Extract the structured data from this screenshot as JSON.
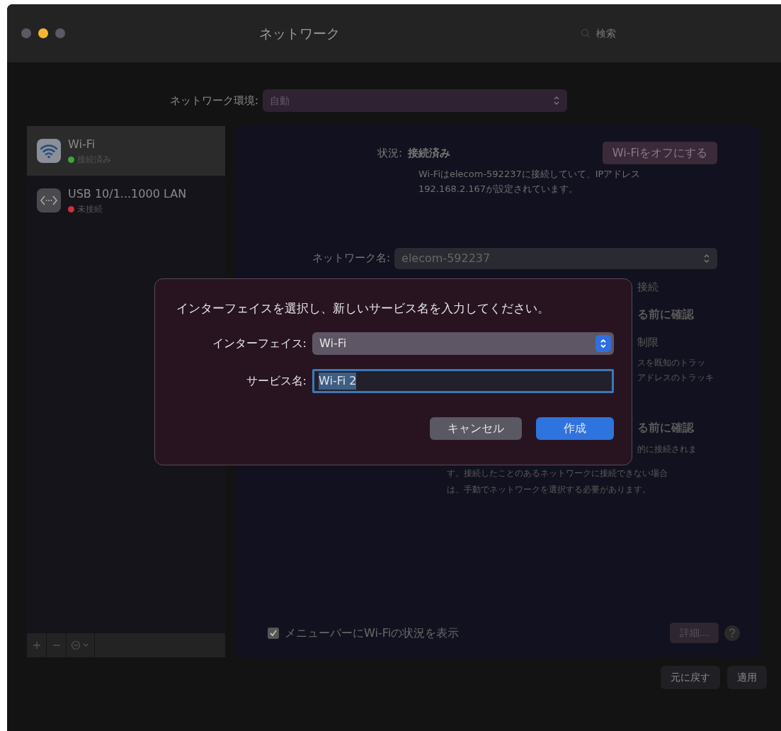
{
  "window": {
    "title": "ネットワーク",
    "search": {
      "placeholder": "検索"
    }
  },
  "location": {
    "label": "ネットワーク環境:",
    "value": "自動"
  },
  "services": [
    {
      "name": "Wi-Fi",
      "status": "接続済み",
      "color": "#3aa63a",
      "kind": "wifi",
      "selected": true
    },
    {
      "name": "USB 10/1...1000 LAN",
      "status": "未接続",
      "color": "#c8333a",
      "kind": "ethernet",
      "selected": false
    }
  ],
  "detail": {
    "status_label": "状況:",
    "status_value": "接続済み",
    "toggle_button": "Wi-Fiをオフにする",
    "description": "Wi-Fiはelecom-592237に接続していて、IPアドレス 192.168.2.167が設定されています。",
    "network_name_label": "ネットワーク名:",
    "network_name": "elecom-592237",
    "hidden_lines": [
      {
        "text": "接続",
        "kind": "option"
      },
      {
        "text": "る前に確認",
        "kind": "heading"
      },
      {
        "text": "制限",
        "kind": "option"
      },
      {
        "text": "スを既知のトラッ",
        "kind": "note"
      },
      {
        "text": "アドレスのトラッキ",
        "kind": "note"
      },
      {
        "text": "る前に確認",
        "kind": "heading"
      },
      {
        "text": "的に接続されま",
        "kind": "note"
      },
      {
        "text": "す。接続したことのあるネットワークに接続できない場合",
        "kind": "note_wide"
      },
      {
        "text": "は、手動でネットワークを選択する必要があります。",
        "kind": "note_wide"
      }
    ],
    "menu_checkbox": {
      "label": "メニューバーにWi-Fiの状況を表示",
      "checked": true
    },
    "advanced_button": "詳細..."
  },
  "footer_buttons": [
    {
      "label": "元に戻す",
      "disabled": true
    },
    {
      "label": "適用",
      "disabled": true
    }
  ],
  "dialog": {
    "message": "インターフェイスを選択し、新しいサービス名を入力してください。",
    "interface_label": "インターフェイス:",
    "interface_value": "Wi-Fi",
    "service_label": "サービス名:",
    "service_value": "Wi-Fi 2",
    "buttons": [
      {
        "label": "キャンセル",
        "kind": "cancel"
      },
      {
        "label": "作成",
        "kind": "default"
      }
    ]
  }
}
